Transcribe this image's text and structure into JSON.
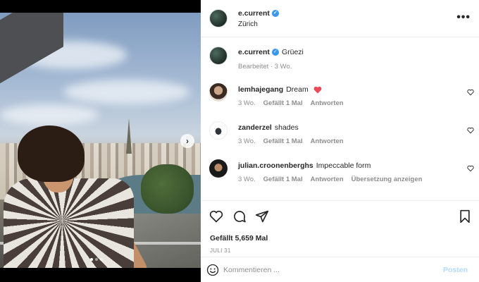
{
  "post": {
    "author": "e.current",
    "location": "Zürich",
    "more_icon": "more-horizontal-icon"
  },
  "caption": {
    "author": "e.current",
    "text": "Grüezi",
    "meta": "Bearbeitet · 3 Wo."
  },
  "comments": [
    {
      "user": "lemhajegang",
      "text": "Dream",
      "age": "3 Wo.",
      "likes": "Gefällt 1 Mal",
      "reply": "Antworten",
      "emoji": "red-heart"
    },
    {
      "user": "zanderzel",
      "text": "shades",
      "age": "3 Wo.",
      "likes": "Gefällt 1 Mal",
      "reply": "Antworten"
    },
    {
      "user": "julian.croonenberghs",
      "text": "Impeccable form",
      "age": "3 Wo.",
      "likes": "Gefällt 1 Mal",
      "reply": "Antworten",
      "translate": "Übersetzung anzeigen"
    }
  ],
  "actions": {
    "like_icon": "heart-icon",
    "comment_icon": "comment-icon",
    "share_icon": "send-icon",
    "save_icon": "bookmark-icon"
  },
  "likes_text": "Gefällt 5,659 Mal",
  "date_text": "JULI 31",
  "composer": {
    "placeholder": "Kommentieren ...",
    "post_label": "Posten"
  },
  "colors": {
    "verified": "#3897f0",
    "heart_red": "#ed4956",
    "post_disabled": "#b3dbff",
    "muted": "#8e8e8e"
  },
  "carousel": {
    "current_index": 1,
    "total": 3
  }
}
